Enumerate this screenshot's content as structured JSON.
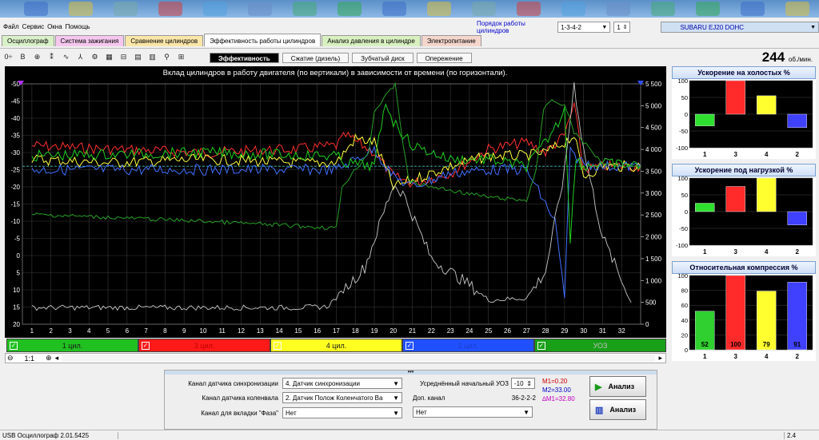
{
  "menu": {
    "items": [
      "Файл",
      "Сервис",
      "Окна",
      "Помощь"
    ]
  },
  "header": {
    "order_label": "Порядок работы цилиндров",
    "order_value": "1-3-4-2",
    "cyl_count": "1",
    "car": "SUBARU EJ20 DOHC"
  },
  "tabs": [
    "Осциллограф",
    "Система зажигания",
    "Сравнение цилиндров",
    "Эффективность работы цилиндров",
    "Анализ давления в цилиндре",
    "Электропитание"
  ],
  "tab_colors": [
    "#d9f0c8",
    "#f5c7ee",
    "#fae6a8",
    "#ffffff",
    "#d8f0c0",
    "#f5d6cc"
  ],
  "subtabs": [
    "Эффективность",
    "Сжатие (дизель)",
    "Зубчатый диск",
    "Опережение"
  ],
  "rpm": {
    "value": "244",
    "unit": "об./мин."
  },
  "chart_data": {
    "type": "line",
    "title": "Вклад цилиндров в работу двигателя (по вертикали) в зависимости от времени (по горизонтали).",
    "x_ticks": [
      "1",
      "2",
      "3",
      "4",
      "5",
      "6",
      "7",
      "8",
      "9",
      "10",
      "11",
      "12",
      "13",
      "14",
      "15",
      "16",
      "17",
      "18",
      "19",
      "20",
      "21",
      "22",
      "23",
      "24",
      "25",
      "26",
      "27",
      "28",
      "29",
      "30",
      "31",
      "32"
    ],
    "y_left_ticks": [
      "-50",
      "-45",
      "-40",
      "-35",
      "-30",
      "-25",
      "-20",
      "-15",
      "-10",
      "-5",
      "0",
      "5",
      "10",
      "15",
      "20"
    ],
    "y_right_ticks": [
      "5 500",
      "5 000",
      "4 500",
      "4 000",
      "3 500",
      "3 000",
      "2 500",
      "2 000",
      "1 500",
      "1 000",
      "500",
      "0"
    ],
    "ylim": [
      -50,
      20
    ],
    "y2lim": [
      0,
      5500
    ],
    "grid": true,
    "series": [
      {
        "color": "#ff3030",
        "x": [
          1,
          5,
          10,
          15,
          17,
          17.5,
          19,
          20,
          21,
          23,
          25,
          27,
          28,
          29,
          29.5,
          30,
          31,
          33
        ],
        "y": [
          -32,
          -31,
          -30,
          -31,
          -32,
          -35,
          -30,
          -23,
          -21,
          -24,
          -31,
          -33,
          -30,
          -35,
          -44,
          -25,
          -26,
          -26
        ]
      },
      {
        "color": "#ffff40",
        "x": [
          1,
          5,
          10,
          15,
          17,
          18,
          19,
          20,
          21,
          23,
          25,
          27,
          28,
          29,
          29.5,
          30,
          31,
          33
        ],
        "y": [
          -28,
          -27,
          -28,
          -27,
          -27,
          -34,
          -33,
          -20,
          -22,
          -26,
          -29,
          -29,
          -30,
          -33,
          -35,
          -23,
          -26,
          -26
        ]
      },
      {
        "color": "#4070ff",
        "x": [
          1,
          10,
          16,
          17,
          19,
          20,
          21,
          23,
          25,
          27,
          28.5,
          29,
          29.3,
          30,
          31,
          33
        ],
        "y": [
          -25,
          -25,
          -25,
          -25,
          -31,
          -23,
          -20,
          -24,
          -25,
          -25,
          -10,
          12,
          -30,
          -27,
          -26,
          -26
        ]
      },
      {
        "color": "#20d020",
        "x": [
          1,
          10,
          17,
          17.5,
          19,
          19.6,
          20,
          21,
          23,
          25,
          27,
          28,
          28.8,
          29,
          29.3,
          29.6,
          30,
          31,
          33
        ],
        "y": [
          -29,
          -30,
          -29,
          -27,
          -26,
          -45,
          -39,
          -32,
          -28,
          -28,
          -26,
          -33,
          -40,
          -44,
          -5,
          -28,
          -26,
          -27,
          -26
        ]
      },
      {
        "color": "#c8c8c8",
        "x": [
          1,
          5,
          10,
          15,
          16.5,
          17,
          18.5,
          20,
          20.5,
          22,
          24,
          25,
          27,
          28,
          29,
          29.5,
          30,
          31,
          32.5
        ],
        "y": [
          380,
          380,
          380,
          380,
          400,
          600,
          1300,
          3200,
          3000,
          1500,
          900,
          550,
          600,
          1200,
          3500,
          5500,
          4000,
          2000,
          500
        ]
      },
      {
        "color": "#28a028",
        "x": [
          1,
          10,
          17,
          17.3,
          18.7,
          19,
          20.1,
          20.5,
          20.8,
          21.2,
          22,
          23,
          25,
          27,
          27.5,
          27.9,
          28.2,
          29,
          29.5,
          31,
          33
        ],
        "y": [
          -12,
          -10,
          -8,
          -20,
          -30,
          -42,
          -50,
          -33,
          -22,
          -21,
          -20,
          -19,
          -17,
          -16,
          -25,
          -42,
          -45,
          -44,
          -36,
          -27,
          -26
        ]
      }
    ]
  },
  "legend": [
    {
      "label": "1 цил.",
      "color": "#20c020",
      "text": "#1a1a1a"
    },
    {
      "label": "3 цил.",
      "color": "#ff1a1a",
      "text": "#c00000"
    },
    {
      "label": "4 цил.",
      "color": "#ffff20",
      "text": "#1a1a1a"
    },
    {
      "label": "2 цил.",
      "color": "#2050ff",
      "text": "#1a3fcc"
    },
    {
      "label": "УОЗ",
      "color": "#18a018",
      "text": "#c0c0c0"
    }
  ],
  "zoom": {
    "value": "1:1"
  },
  "panels": [
    {
      "title": "Ускорение на холостых %",
      "ticks": [
        "100",
        "50",
        "0",
        "-50",
        "-100"
      ],
      "ymin": -100,
      "ymax": 100,
      "categories": [
        "1",
        "3",
        "4",
        "2"
      ],
      "values": [
        -35,
        100,
        55,
        -40
      ],
      "colors": [
        "#30e030",
        "#ff2a2a",
        "#ffff30",
        "#4040ff"
      ],
      "labels": null
    },
    {
      "title": "Ускорение под нагрузкой %",
      "ticks": [
        "100",
        "50",
        "0",
        "-50",
        "-100"
      ],
      "ymin": -100,
      "ymax": 100,
      "categories": [
        "1",
        "3",
        "4",
        "2"
      ],
      "values": [
        25,
        75,
        100,
        -40
      ],
      "colors": [
        "#30e030",
        "#ff2a2a",
        "#ffff30",
        "#4040ff"
      ],
      "labels": null
    },
    {
      "title": "Относительная компрессия %",
      "ticks": [
        "100",
        "80",
        "60",
        "40",
        "20",
        "0"
      ],
      "ymin": 0,
      "ymax": 100,
      "categories": [
        "1",
        "3",
        "4",
        "2"
      ],
      "values": [
        52,
        100,
        79,
        91
      ],
      "colors": [
        "#30d030",
        "#ff2a2a",
        "#ffff30",
        "#4040ff"
      ],
      "labels": [
        "52",
        "100",
        "79",
        "91"
      ]
    }
  ],
  "bottom": {
    "sync_label": "Канал датчика синхронизации",
    "sync_value": "4. Датчик синхронизации",
    "crank_label": "Канал датчика коленвала",
    "crank_value": "2. Датчик Полож Коленчатого Ва",
    "phase_label": "Канал для вкладки \"Фаза\"",
    "phase_value": "Нет",
    "uoz_label": "Усреднённый начальный УОЗ",
    "uoz_value": "-10",
    "extra_label": "Доп. канал",
    "extra_value": "Нет",
    "extra_code": "36-2-2-2",
    "m1": "M1=0.20",
    "m2": "M2=33.00",
    "dm1": "∆M1=32.80",
    "analyze1": "Анализ",
    "analyze2": "Анализ"
  },
  "status": {
    "left": "USB Осциллограф  2.01.5425",
    "right": "2.4"
  }
}
